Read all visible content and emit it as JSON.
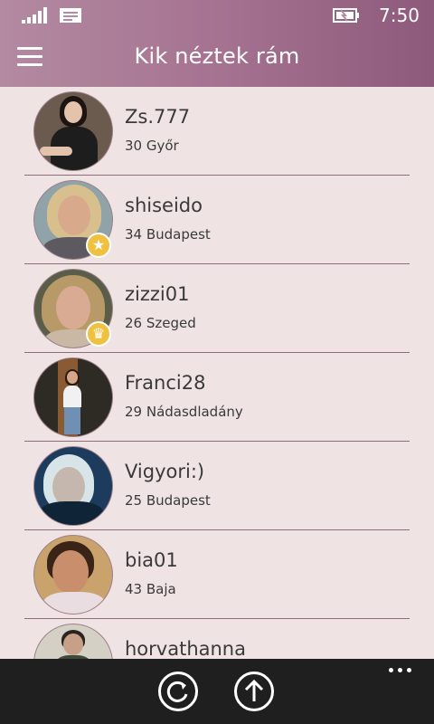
{
  "status_bar": {
    "time": "7:50"
  },
  "header": {
    "title": "Kik néztek rám"
  },
  "profiles": [
    {
      "name": "Zs.777",
      "age_city": "30 Győr",
      "badge": ""
    },
    {
      "name": "shiseido",
      "age_city": "34 Budapest",
      "badge": "star"
    },
    {
      "name": "zizzi01",
      "age_city": "26 Szeged",
      "badge": "crown"
    },
    {
      "name": "Franci28",
      "age_city": "29 Nádasdladány",
      "badge": ""
    },
    {
      "name": "Vigyori:)",
      "age_city": "25 Budapest",
      "badge": ""
    },
    {
      "name": "bia01",
      "age_city": "43 Baja",
      "badge": ""
    },
    {
      "name": "horvathanna",
      "age_city": "",
      "badge": ""
    }
  ],
  "app_bar": {
    "buttons": [
      "refresh-icon",
      "upload-arrow-icon"
    ],
    "more": "ellipsis-icon"
  },
  "colors": {
    "accent": "#a4708f",
    "background": "#efe3e3",
    "separator": "#8f6d7c",
    "badge": "#f0c040"
  }
}
